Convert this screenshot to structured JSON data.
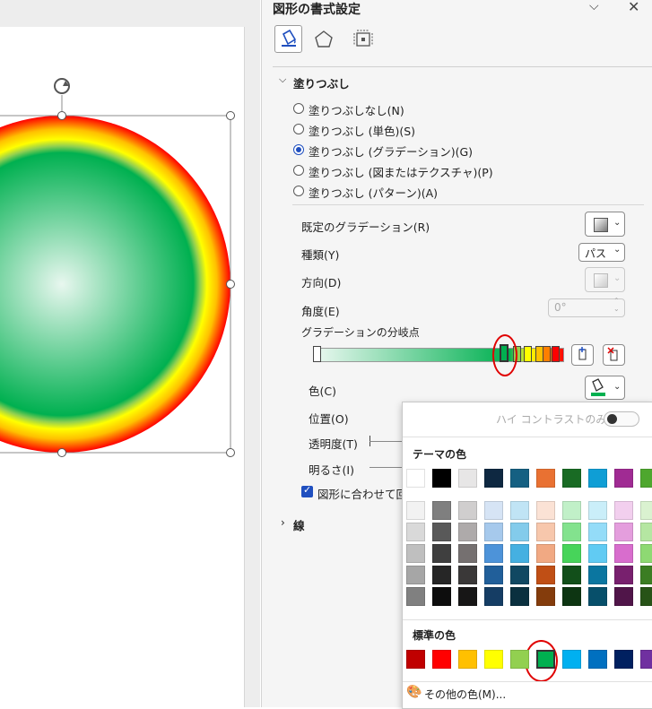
{
  "pane": {
    "title": "図形の書式設定",
    "tabs": [
      "fill-line-icon",
      "effects-icon",
      "size-properties-icon"
    ],
    "fill_section": "塗りつぶし",
    "fill_options": [
      {
        "label": "塗りつぶしなし(N)",
        "selected": false
      },
      {
        "label": "塗りつぶし (単色)(S)",
        "selected": false
      },
      {
        "label": "塗りつぶし (グラデーション)(G)",
        "selected": true
      },
      {
        "label": "塗りつぶし (図またはテクスチャ)(P)",
        "selected": false
      },
      {
        "label": "塗りつぶし (パターン)(A)",
        "selected": false
      }
    ],
    "preset_gradient_label": "既定のグラデーション(R)",
    "type_label": "種類(Y)",
    "type_value": "パス",
    "direction_label": "方向(D)",
    "angle_label": "角度(E)",
    "angle_value": "0°",
    "stops_label": "グラデーションの分岐点",
    "color_label": "色(C)",
    "position_label": "位置(O)",
    "transparency_label": "透明度(T)",
    "brightness_label": "明るさ(I)",
    "rotate_label": "図形に合わせて回転",
    "line_section": "線"
  },
  "popup": {
    "high_contrast_label": "ハイ コントラストのみ(H)",
    "theme_colors_label": "テーマの色",
    "standard_colors_label": "標準の色",
    "more_colors_label": "その他の色(M)...",
    "theme_colors": [
      "#ffffff",
      "#000000",
      "#e7e6e6",
      "#0e2841",
      "#156082",
      "#e97132",
      "#196b24",
      "#0f9ed5",
      "#a02b93",
      "#4ea72e"
    ],
    "theme_shades": [
      [
        "#f2f2f2",
        "#7f7f7f",
        "#d0cece",
        "#d6e4f5",
        "#c0e4f5",
        "#fbe2d5",
        "#c1f0c8",
        "#caeef9",
        "#f2cfee",
        "#daf2d0"
      ],
      [
        "#d9d9d9",
        "#595959",
        "#aeaaaa",
        "#a6c9ec",
        "#83cbeb",
        "#f7c7ac",
        "#83e28e",
        "#94dcf8",
        "#e49edd",
        "#b5e6a2"
      ],
      [
        "#bfbfbf",
        "#3f3f3f",
        "#757070",
        "#4d93d9",
        "#45b0e1",
        "#f1a983",
        "#47d45a",
        "#61cbf3",
        "#d86dcd",
        "#8ed973"
      ],
      [
        "#a6a6a6",
        "#262626",
        "#3a3838",
        "#215f9a",
        "#104862",
        "#c04f15",
        "#124f1a",
        "#0b76a0",
        "#78206e",
        "#3b7d23"
      ],
      [
        "#808080",
        "#0d0d0d",
        "#171616",
        "#153d64",
        "#0a303f",
        "#843c0c",
        "#0d3512",
        "#074f6a",
        "#501549",
        "#275317"
      ]
    ],
    "standard_colors": [
      "#c00000",
      "#ff0000",
      "#ffc000",
      "#ffff00",
      "#92d050",
      "#00b050",
      "#00b0f0",
      "#0070c0",
      "#002060",
      "#7030a0"
    ]
  },
  "colors": {
    "accent": "#1f4fbf",
    "highlight": "#e00000",
    "green_stop": "#00b050"
  }
}
